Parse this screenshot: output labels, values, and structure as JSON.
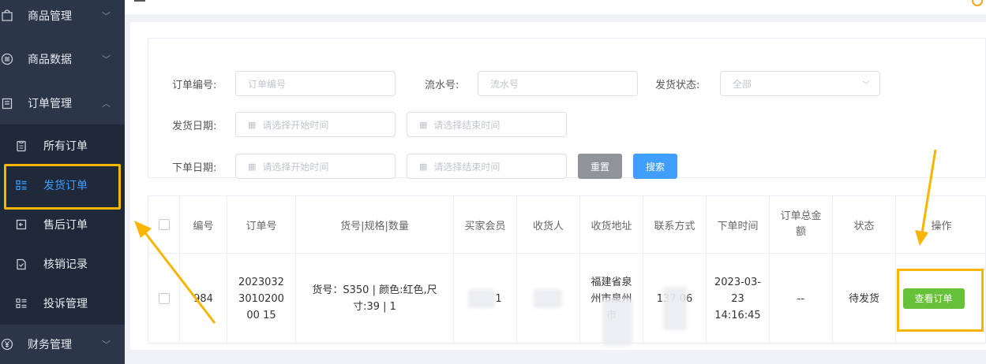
{
  "sidebar": {
    "items": [
      {
        "label": "商品管理",
        "icon": "shopping-bag-icon"
      },
      {
        "label": "商品数据",
        "icon": "list-circle-icon"
      },
      {
        "label": "订单管理",
        "icon": "clipboard-icon"
      },
      {
        "label": "所有订单",
        "icon": "clipboard-list-icon"
      },
      {
        "label": "发货订单",
        "icon": "list-grid-icon"
      },
      {
        "label": "售后订单",
        "icon": "return-box-icon"
      },
      {
        "label": "核销记录",
        "icon": "document-check-icon"
      },
      {
        "label": "投诉管理",
        "icon": "list-grid-icon"
      },
      {
        "label": "财务管理",
        "icon": "yen-circle-icon"
      }
    ],
    "active_item": "发货订单"
  },
  "filters": {
    "order_no_label": "订单编号:",
    "order_no_placeholder": "订单编号",
    "serial_label": "流水号:",
    "serial_placeholder": "流水号",
    "ship_status_label": "发货状态:",
    "ship_status_value": "全部",
    "ship_date_label": "发货日期:",
    "order_date_label": "下单日期:",
    "start_placeholder": "请选择开始时间",
    "end_placeholder": "请选择结束时间",
    "reset_label": "重置",
    "search_label": "搜索"
  },
  "table": {
    "headers": [
      "编号",
      "订单号",
      "货号|规格|数量",
      "买家会员",
      "收货人",
      "收货地址",
      "联系方式",
      "下单时间",
      "订单总金额",
      "状态",
      "操作"
    ],
    "rows": [
      {
        "id": "984",
        "order_no": "2023032301020000 15",
        "goods": "货号：S350 | 颜色:红色,尺寸:39 | 1",
        "buyer": "1",
        "receiver": "",
        "address": "福建省泉州市泉州市",
        "phone": "137 06",
        "order_time": "2023-03-23 14:16:45",
        "total": "--",
        "status": "待发货",
        "action": "查看订单"
      }
    ]
  },
  "colors": {
    "sidebar_bg": "#2b3649",
    "active": "#409eff",
    "highlight": "#f7b500",
    "view_button": "#67c23a",
    "search_button": "#409eff",
    "reset_button": "#909399"
  }
}
